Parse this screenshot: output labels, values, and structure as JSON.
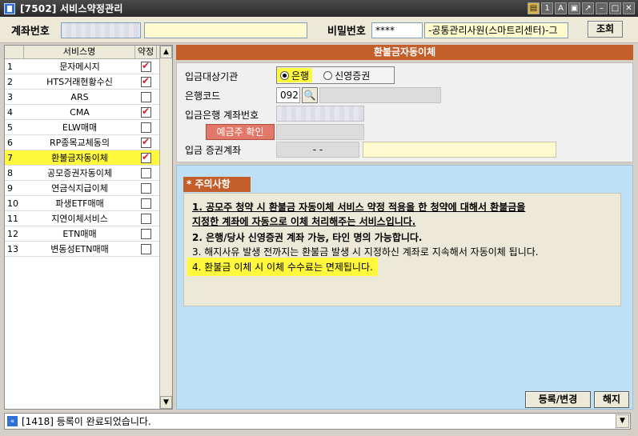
{
  "window": {
    "title": "[7502] 서비스약정관리",
    "controls": [
      "copy-icon",
      "help-icon",
      "font-icon",
      "lock-icon",
      "popout-icon",
      "minimize-icon",
      "maximize-icon",
      "close-icon"
    ]
  },
  "account": {
    "account_label": "계좌번호",
    "account_value": "",
    "password_label": "비밀번호",
    "password_value": "****",
    "staff_value": "-공통관리사원(스마트리센터)-그",
    "lookup_button": "조회"
  },
  "service_list": {
    "headers": [
      "서비스명",
      "약정"
    ],
    "items": [
      {
        "num": "1",
        "name": "문자메시지",
        "checked": true
      },
      {
        "num": "2",
        "name": "HTS거래현황수신",
        "checked": true
      },
      {
        "num": "3",
        "name": "ARS",
        "checked": false
      },
      {
        "num": "4",
        "name": "CMA",
        "checked": true
      },
      {
        "num": "5",
        "name": "ELW매매",
        "checked": false
      },
      {
        "num": "6",
        "name": "RP종목교체동의",
        "checked": true
      },
      {
        "num": "7",
        "name": "환불금자동이체",
        "checked": true,
        "selected": true
      },
      {
        "num": "8",
        "name": "공모증권자동이체",
        "checked": false
      },
      {
        "num": "9",
        "name": "연금식지급이체",
        "checked": false
      },
      {
        "num": "10",
        "name": "파생ETF매매",
        "checked": false
      },
      {
        "num": "11",
        "name": "지연이체서비스",
        "checked": false
      },
      {
        "num": "12",
        "name": "ETN매매",
        "checked": false
      },
      {
        "num": "13",
        "name": "변동성ETN매매",
        "checked": false
      }
    ]
  },
  "detail": {
    "section_title": "환불금자동이체",
    "institution_label": "입금대상기관",
    "radio_bank": "은행",
    "radio_securities": "신영증권",
    "bank_code_label": "은행코드",
    "bank_code_value": "092",
    "account_no_label": "입금은행 계좌번호",
    "deposit_check_button": "예금주 확인",
    "securities_account_label": "입금 증권계좌",
    "securities_account_value": "-    -"
  },
  "notice": {
    "tag": "* 주의사항",
    "line1a": "1. 공모주 청약 시 환불금 자동이체 서비스 약정 적용을 한 청약에 대해서 환불금을",
    "line1b": "지정한 계좌에 자동으로 이체 처리해주는 서비스입니다.",
    "line2": "2. 은행/당사 신영증권 계좌 가능, 타인 명의 가능합니다.",
    "line3": "3. 해지사유 발생 전까지는 환불금 발생 시 지정하신 계좌로 지속해서 자동이체 됩니다.",
    "line4": "4. 환불금 이체 시 이체 수수료는 면제됩니다."
  },
  "actions": {
    "register_button": "등록/변경",
    "cancel_button": "해지"
  },
  "status": {
    "message": "[1418] 등록이 완료되었습니다."
  }
}
